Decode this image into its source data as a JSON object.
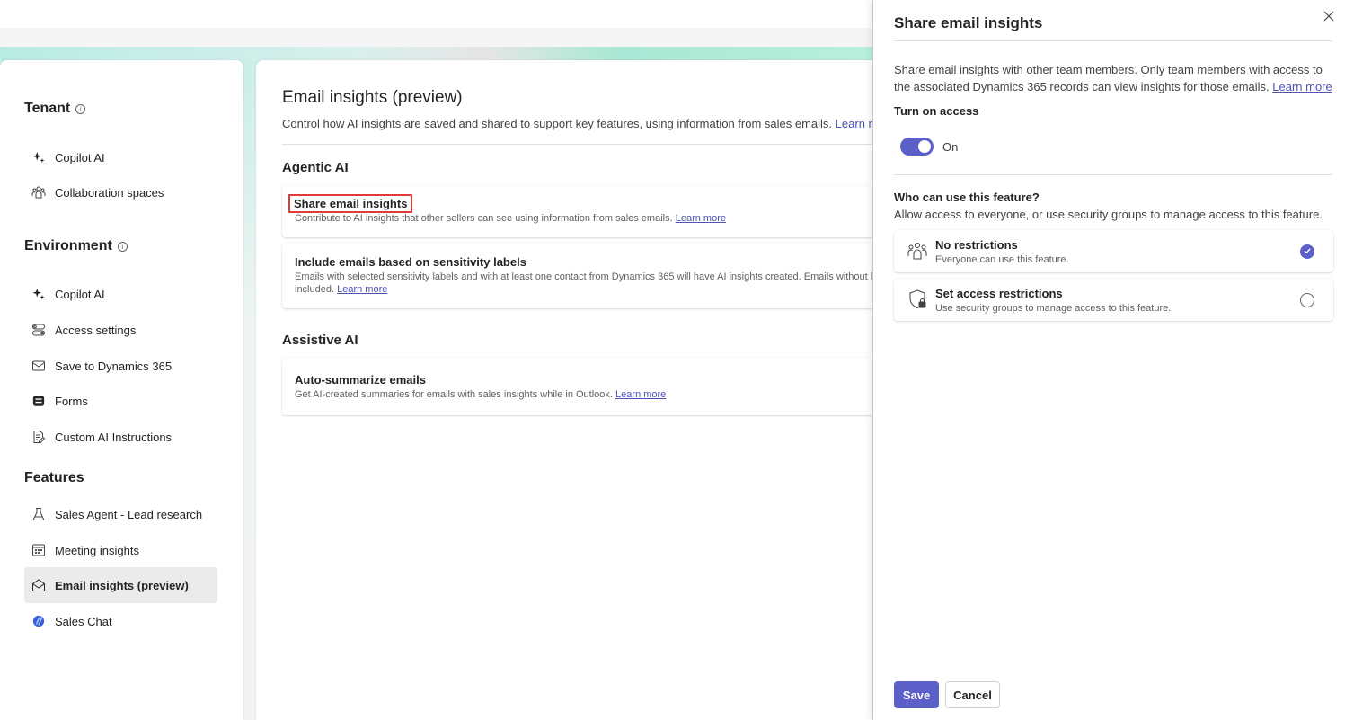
{
  "colors": {
    "accent": "#5b5fc7",
    "highlight": "#e03a3a"
  },
  "nav": {
    "tenant_title": "Tenant",
    "environment_title": "Environment",
    "features_title": "Features",
    "tenant_items": [
      {
        "label": "Copilot AI",
        "icon": "sparkle-icon"
      },
      {
        "label": "Collaboration spaces",
        "icon": "people-group-icon"
      }
    ],
    "environment_items": [
      {
        "label": "Copilot AI",
        "icon": "sparkle-icon"
      },
      {
        "label": "Access settings",
        "icon": "toggle-settings-icon"
      },
      {
        "label": "Save to Dynamics 365",
        "icon": "mail-icon"
      },
      {
        "label": "Forms",
        "icon": "form-icon"
      },
      {
        "label": "Custom AI Instructions",
        "icon": "document-edit-icon"
      }
    ],
    "feature_items": [
      {
        "label": "Sales Agent - Lead research",
        "icon": "beaker-icon"
      },
      {
        "label": "Meeting insights",
        "icon": "calendar-icon"
      },
      {
        "label": "Email insights (preview)",
        "icon": "mail-open-icon",
        "selected": true
      },
      {
        "label": "Sales Chat",
        "icon": "sales-chat-icon"
      }
    ]
  },
  "main": {
    "title": "Email insights (preview)",
    "description": "Control how AI insights are saved and shared to support key features, using information from sales emails.",
    "learn_more": "Learn more",
    "agentic_title": "Agentic AI",
    "assistive_title": "Assistive AI",
    "cards": {
      "share": {
        "title": "Share email insights",
        "desc": "Contribute to AI insights that other sellers can see using information from sales emails.",
        "link": "Learn more"
      },
      "sensitivity": {
        "title": "Include emails based on sensitivity labels",
        "desc_line1": "Emails with selected sensitivity labels and with at least one contact from Dynamics 365 will have AI insights created. Emails without labe",
        "desc_line2": "included.",
        "link": "Learn more"
      },
      "summarize": {
        "title": "Auto-summarize emails",
        "desc": "Get AI-created summaries for emails with sales insights while in Outlook.",
        "link": "Learn more"
      }
    }
  },
  "panel": {
    "title": "Share email insights",
    "description": "Share email insights with other team members. Only team members with access to the associated Dynamics 365 records can view insights for those emails.",
    "learn_more": "Learn more",
    "turn_on_label": "Turn on access",
    "toggle_state": "On",
    "who_label": "Who can use this feature?",
    "who_desc": "Allow access to everyone, or use security groups to manage access to this feature.",
    "options": [
      {
        "title": "No restrictions",
        "desc": "Everyone can use this feature.",
        "selected": true
      },
      {
        "title": "Set access restrictions",
        "desc": "Use security groups to manage access to this feature.",
        "selected": false
      }
    ],
    "save_label": "Save",
    "cancel_label": "Cancel"
  }
}
